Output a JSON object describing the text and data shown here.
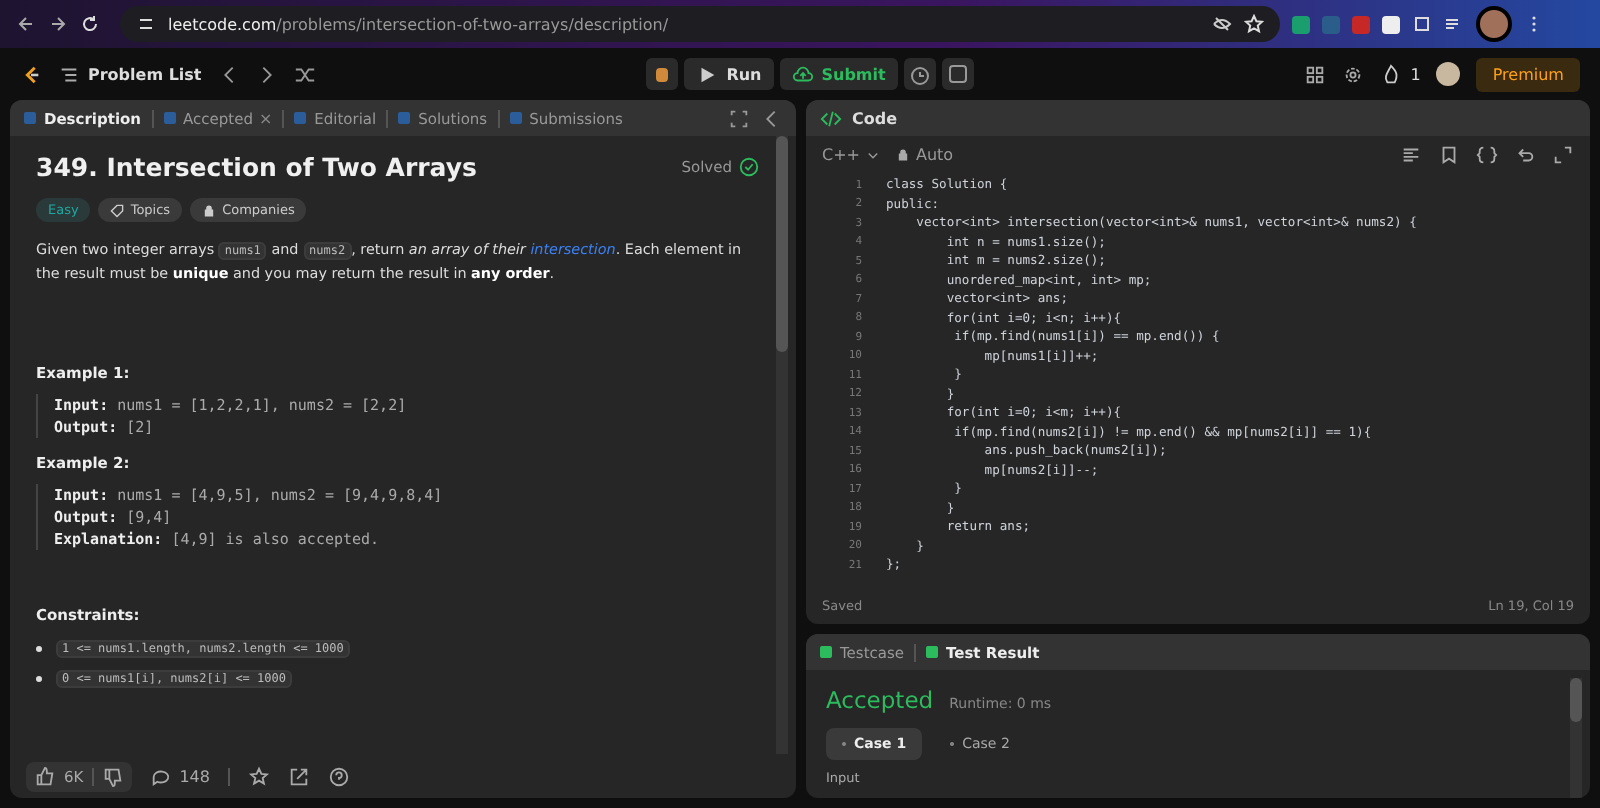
{
  "browser": {
    "url_host": "leetcode.com",
    "url_path": "/problems/intersection-of-two-arrays/description/"
  },
  "toolbar": {
    "problem_list": "Problem List",
    "run": "Run",
    "submit": "Submit",
    "streak": "1",
    "premium": "Premium"
  },
  "left_tabs": [
    {
      "label": "Description",
      "selected": true
    },
    {
      "label": "Accepted",
      "selected": false,
      "close": "×"
    },
    {
      "label": "Editorial",
      "selected": false
    },
    {
      "label": "Solutions",
      "selected": false
    },
    {
      "label": "Submissions",
      "selected": false
    }
  ],
  "problem": {
    "title": "349. Intersection of Two Arrays",
    "status": "Solved",
    "difficulty": "Easy",
    "tags": [
      "Topics",
      "Companies"
    ],
    "description": [
      {
        "kind": "text",
        "text": "Given two integer arrays "
      },
      {
        "kind": "code",
        "text": "nums1"
      },
      {
        "kind": "text",
        "text": " and "
      },
      {
        "kind": "code",
        "text": "nums2"
      },
      {
        "kind": "text",
        "text": ", return *an array of their* "
      },
      {
        "kind": "link",
        "text": "intersection"
      },
      {
        "kind": "text",
        "text": ". Each element in the result must be **unique** and you may return the result in **any order**."
      }
    ],
    "examples": [
      {
        "title": "Example 1:",
        "lines": [
          "**Input:** nums1 = [1,2,2,1], nums2 = [2,2]",
          "**Output:** [2]"
        ]
      },
      {
        "title": "Example 2:",
        "lines": [
          "**Input:** nums1 = [4,9,5], nums2 = [9,4,9,8,4]",
          "**Output:** [9,4]",
          "**Explanation:** [4,9] is also accepted."
        ]
      }
    ],
    "constraints_title": "Constraints:",
    "constraints": [
      "1 <= nums1.length, nums2.length <= 1000",
      "0 <= nums1[i], nums2[i] <= 1000"
    ]
  },
  "footer": {
    "likes": "6K",
    "comments": "148"
  },
  "code_panel": {
    "title": "Code",
    "language": "C++",
    "mode": "Auto",
    "status": "Saved",
    "position": "Ln 19, Col 19",
    "lines": [
      {
        "number": "1",
        "text": "class Solution {"
      },
      {
        "number": "2",
        "text": "public:"
      },
      {
        "number": "3",
        "text": "    vector<int> intersection(vector<int>& nums1, vector<int>& nums2) {"
      },
      {
        "number": "4",
        "text": "        int n = nums1.size();"
      },
      {
        "number": "5",
        "text": "        int m = nums2.size();"
      },
      {
        "number": "6",
        "text": "        unordered_map<int, int> mp;"
      },
      {
        "number": "7",
        "text": "        vector<int> ans;"
      },
      {
        "number": "8",
        "text": "        for(int i=0; i<n; i++){"
      },
      {
        "number": "9",
        "text": "         if(mp.find(nums1[i]) == mp.end()) {"
      },
      {
        "number": "10",
        "text": "             mp[nums1[i]]++;"
      },
      {
        "number": "11",
        "text": "         }"
      },
      {
        "number": "12",
        "text": "        }"
      },
      {
        "number": "13",
        "text": "        for(int i=0; i<m; i++){"
      },
      {
        "number": "14",
        "text": "         if(mp.find(nums2[i]) != mp.end() && mp[nums2[i]] == 1){"
      },
      {
        "number": "15",
        "text": "             ans.push_back(nums2[i]);"
      },
      {
        "number": "16",
        "text": "             mp[nums2[i]]--;"
      },
      {
        "number": "17",
        "text": "         }"
      },
      {
        "number": "18",
        "text": "        }"
      },
      {
        "number": "19",
        "text": "        return ans;"
      },
      {
        "number": "20",
        "text": "    }"
      },
      {
        "number": "21",
        "text": "};"
      }
    ]
  },
  "result_tabs": [
    {
      "label": "Testcase",
      "selected": false
    },
    {
      "label": "Test Result",
      "selected": true
    }
  ],
  "result": {
    "verdict": "Accepted",
    "runtime": "Runtime: 0 ms",
    "cases": [
      {
        "label": "Case 1",
        "selected": true
      },
      {
        "label": "Case 2",
        "selected": false
      }
    ],
    "input_label": "Input"
  }
}
